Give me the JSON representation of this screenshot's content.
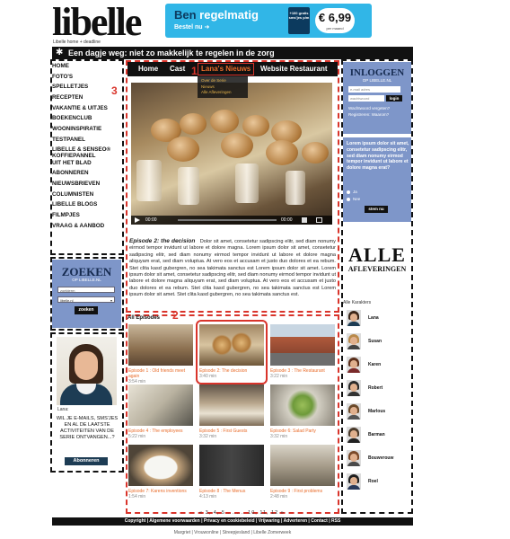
{
  "header": {
    "logo": "libelle",
    "logo_sub": "Libelle home + deadline",
    "banner_line1_a": "Ben",
    "banner_line1_b": " regelmatig",
    "banner_line2": "Bestel nu",
    "banner_promo": "+100 gratis sms'jes p/m",
    "banner_price": "€ 6,99",
    "banner_price_sub": "per maand",
    "headline": "Een dagje weg: niet zo makkelijk te regelen in de zorg"
  },
  "nav": {
    "items": [
      "HOME",
      "FOTO'S",
      "SPELLETJES",
      "RECEPTEN",
      "VAKANTIE & UITJES",
      "BOEKENCLUB",
      "WOONINSPIRATIE",
      "TESTPANEL",
      "LIBELLE & SENSEO® KOFFIEPANNEL",
      "UIT HET BLAD",
      "ABONNEREN",
      "NIEUWSBRIEVEN",
      "COLUMNISTEN",
      "LIBELLE BLOGS",
      "FILMPJES",
      "VRAAG & AANBOD"
    ]
  },
  "search": {
    "title": "ZOEKEN",
    "subtitle": "OP LIBELLE.NL",
    "placeholder": "zoekterm",
    "scope": "libelle.nl",
    "button": "zoeken"
  },
  "lana_promo": {
    "name": "Lana:",
    "message": "WIL JE E-MAILS, SMS'JES EN AL DE LAATSTE ACTIVITEITEN VAN DE SERIE ONTVANGEN...?",
    "button": "Abonneren"
  },
  "video_nav": {
    "home": "Home",
    "cast": "Cast",
    "news": "Lana's Nieuws",
    "restaurant": "Website Restaurant",
    "dropdown": [
      "Over de Serie",
      "Nieuws",
      "Alle Afleveringen"
    ]
  },
  "markers": {
    "one": "1",
    "two": "2",
    "three": "3"
  },
  "video": {
    "time_current": "00:00",
    "time_total": "00:00"
  },
  "episode": {
    "title": "Episode 2: the decision",
    "body": "Dolor sit amet, consetetur sadipscing elitr, sed diam nonumy eirmod tempor invidunt ut labore et dolore magna. Lorem ipsum dolor sit amet, consetetur sadipscing elitr, sed diam nonumy eirmod tempor invidunt ut labore et dolore magna aliquyam erat, sed diam voluptua. At vero eos et accusam et justo duo dolores et ea rebum. Stet clita kasd gubergren, no sea takimata sanctus est Lorem ipsum dolor sit amet. Lorem ipsum dolor sit amet, consetetur sadipscing elitr, sed diam nonumy eirmod tempor invidunt ut labore et dolore magna aliquyam erat, sed diam voluptua. At vero eos et accusam et justo duo dolores et ea rebum. Stet clita kasd gubergren, no sea takimata sanctus est Lorem ipsum dolor sit amet. Stet clita kasd gubergren, no sea takimata sanctus est."
  },
  "episodes": {
    "heading": "All Episodes",
    "items": [
      {
        "title": "Episode 1 : Old friends meet again",
        "meta": "3:54 min"
      },
      {
        "title": "Episode 2: The decision",
        "meta": "3:40 min"
      },
      {
        "title": "Episode 3 : The Restaurant",
        "meta": "3:22 min"
      },
      {
        "title": "Episode 4 : The employees",
        "meta": "5:22 min"
      },
      {
        "title": "Episode 5 : First Guests",
        "meta": "3:32 min"
      },
      {
        "title": "Episode 6: Salad Party",
        "meta": "3:32 min"
      },
      {
        "title": "Episode 7: Karens inventions",
        "meta": "1:54 min"
      },
      {
        "title": "Episode 8 : The Menus",
        "meta": "4:13 min"
      },
      {
        "title": "Episode 9 : First problems",
        "meta": "2:48 min"
      }
    ],
    "pager": "« 3, 4, 5 ........ 10, 11, 12 »"
  },
  "login": {
    "title": "INLOGGEN",
    "subtitle": "OP LIBELLE.NL",
    "email_placeholder": "e-mail adres",
    "password_placeholder": "wachtwoord",
    "button": "login",
    "forgot": "Wachtwoord vergeten?",
    "register": "Registreren: Waarom?"
  },
  "poll": {
    "question": "Lorem ipsum dolor sit amet, consetetur sadipscing elitr, sed diam nonumy eirmod tempor invidunt ut labore et dolore magna erat?",
    "options": [
      "Ja",
      "Nee"
    ],
    "button": "stem nu"
  },
  "alle": {
    "line1": "ALLE",
    "line2": "AFLEVERINGEN"
  },
  "characters": {
    "title": "Alle Karakters",
    "items": [
      "Lana",
      "Susan",
      "Karen",
      "Robert",
      "Marlous",
      "Barman",
      "Bouwvrouw",
      "Roel"
    ]
  },
  "footer": {
    "links": "Copyright | Algemene voorwaarden | Privacy en cookiebeleid | Vrijwaring | Adverteren | Contact | RSS",
    "sub": "Margriet | Vrouwonline | Streepjesland | Libelle Zomerweek"
  },
  "colors": {
    "accent": "#e96c2a",
    "panel": "#7e96c9",
    "marker": "#d9342b",
    "banner": "#31b6e7"
  }
}
